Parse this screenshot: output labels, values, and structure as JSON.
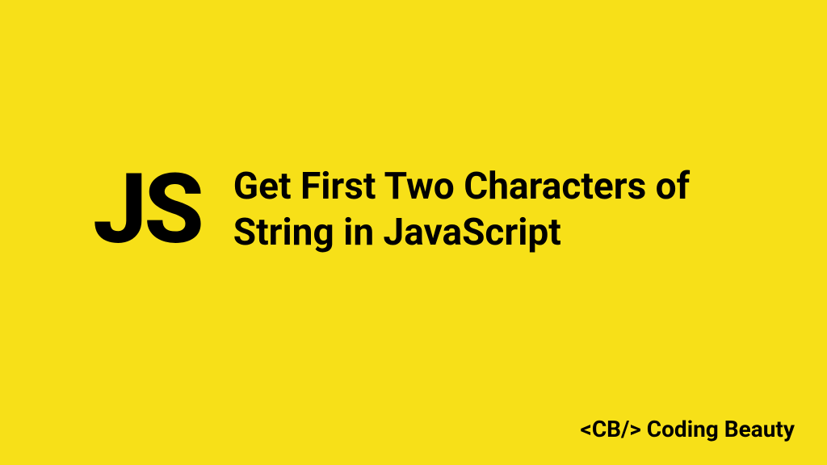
{
  "logo": "JS",
  "title": "Get First Two Characters of String in JavaScript",
  "brand": "<CB/> Coding Beauty"
}
